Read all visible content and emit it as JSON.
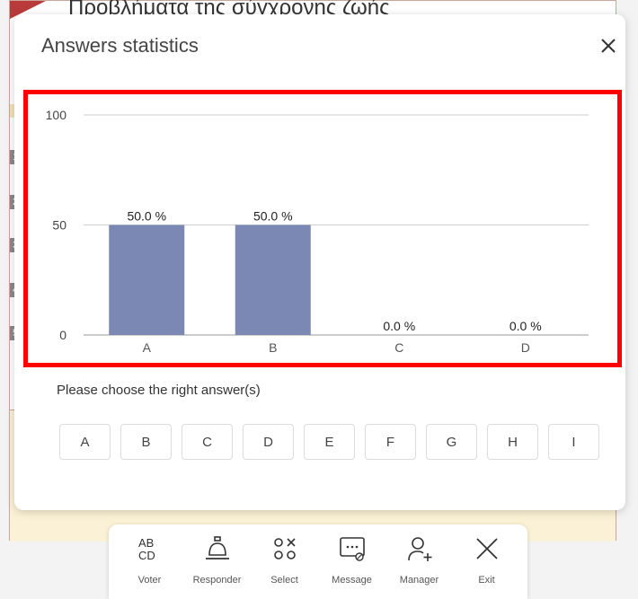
{
  "background": {
    "title": "Προβλήματα της σύγχρονης ζωής",
    "markers": [
      "1",
      "2",
      "3",
      "4",
      "5"
    ]
  },
  "dialog": {
    "title": "Answers statistics",
    "close_icon": "close-icon",
    "prompt": "Please choose the right answer(s)",
    "options": [
      "A",
      "B",
      "C",
      "D",
      "E",
      "F",
      "G",
      "H",
      "I"
    ]
  },
  "chart_data": {
    "type": "bar",
    "categories": [
      "A",
      "B",
      "C",
      "D"
    ],
    "values": [
      50.0,
      50.0,
      0.0,
      0.0
    ],
    "value_labels": [
      "50.0 %",
      "50.0 %",
      "0.0 %",
      "0.0 %"
    ],
    "yticks": [
      0,
      50,
      100
    ],
    "ylim": [
      0,
      100
    ],
    "bar_color": "#7a88b3",
    "grid": true
  },
  "toolbar": {
    "items": [
      {
        "label": "Voter",
        "icon": "voter-abcd-icon"
      },
      {
        "label": "Responder",
        "icon": "bell-icon"
      },
      {
        "label": "Select",
        "icon": "select-shapes-icon"
      },
      {
        "label": "Message",
        "icon": "message-icon"
      },
      {
        "label": "Manager",
        "icon": "add-user-icon"
      },
      {
        "label": "Exit",
        "icon": "close-icon"
      }
    ]
  }
}
